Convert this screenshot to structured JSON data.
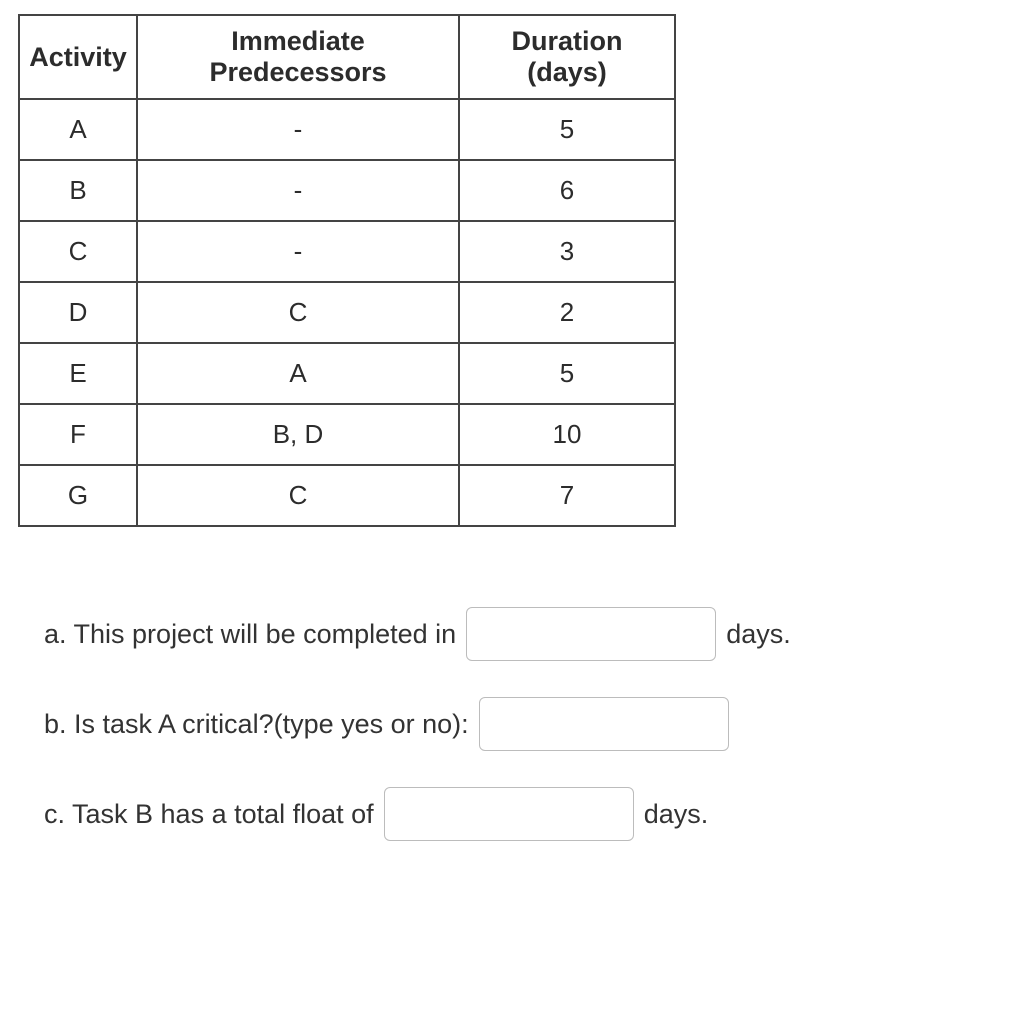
{
  "table": {
    "headers": {
      "activity": "Activity",
      "predecessors": "Immediate Predecessors",
      "duration": "Duration (days)"
    },
    "rows": [
      {
        "activity": "A",
        "predecessors": "-",
        "duration": "5"
      },
      {
        "activity": "B",
        "predecessors": "-",
        "duration": "6"
      },
      {
        "activity": "C",
        "predecessors": "-",
        "duration": "3"
      },
      {
        "activity": "D",
        "predecessors": "C",
        "duration": "2"
      },
      {
        "activity": "E",
        "predecessors": "A",
        "duration": "5"
      },
      {
        "activity": "F",
        "predecessors": "B, D",
        "duration": "10"
      },
      {
        "activity": "G",
        "predecessors": "C",
        "duration": "7"
      }
    ]
  },
  "questions": {
    "a_prefix": "a. This project will be completed in",
    "a_suffix": "days.",
    "b_prefix": "b. Is task A critical?(type yes or no):",
    "c_prefix": "c. Task B has a total float of",
    "c_suffix": "days."
  }
}
